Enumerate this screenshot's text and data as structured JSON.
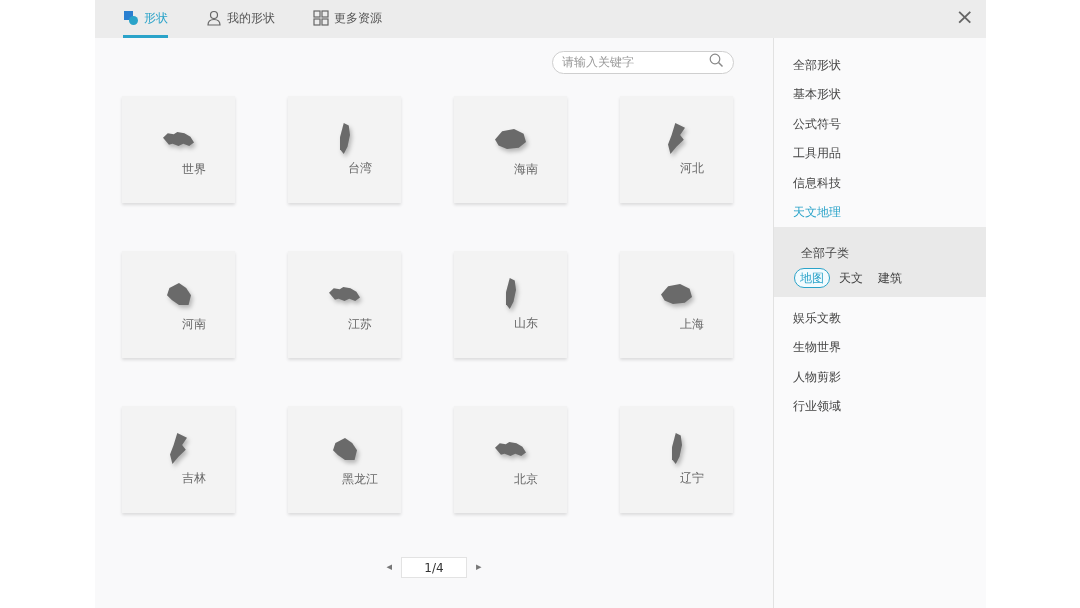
{
  "tabs": [
    {
      "label": "形状",
      "selected": true
    },
    {
      "label": "我的形状",
      "selected": false
    },
    {
      "label": "更多资源",
      "selected": false
    }
  ],
  "close": "×",
  "search": {
    "placeholder": "请输入关键字"
  },
  "shapes": [
    {
      "label": "世界"
    },
    {
      "label": "台湾"
    },
    {
      "label": "海南"
    },
    {
      "label": "河北"
    },
    {
      "label": "河南"
    },
    {
      "label": "江苏"
    },
    {
      "label": "山东"
    },
    {
      "label": "上海"
    },
    {
      "label": "吉林"
    },
    {
      "label": "黑龙江"
    },
    {
      "label": "北京"
    },
    {
      "label": "辽宁"
    }
  ],
  "pagination": {
    "prev": "◂",
    "page": "1/4",
    "next": "▸"
  },
  "categories": [
    {
      "label": "全部形状",
      "selected": false
    },
    {
      "label": "基本形状",
      "selected": false
    },
    {
      "label": "公式符号",
      "selected": false
    },
    {
      "label": "工具用品",
      "selected": false
    },
    {
      "label": "信息科技",
      "selected": false
    },
    {
      "label": "天文地理",
      "selected": true,
      "expanded": true,
      "sub_title": "全部子类",
      "children": [
        {
          "label": "地图",
          "selected": true
        },
        {
          "label": "天文",
          "selected": false
        },
        {
          "label": "建筑",
          "selected": false
        }
      ]
    },
    {
      "label": "娱乐文教",
      "selected": false
    },
    {
      "label": "生物世界",
      "selected": false
    },
    {
      "label": "人物剪影",
      "selected": false
    },
    {
      "label": "行业领域",
      "selected": false
    }
  ]
}
